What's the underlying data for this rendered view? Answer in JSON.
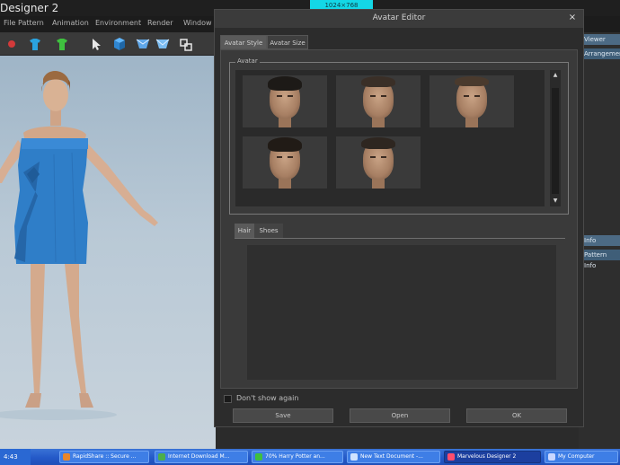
{
  "app": {
    "title": "Designer 2",
    "resolution_badge": "1024×768"
  },
  "menu": {
    "items": [
      "File",
      "Pattern",
      "Animation",
      "Environment",
      "Render",
      "Window"
    ]
  },
  "toolbar": {
    "tools": [
      "record-icon",
      "shirt-icon",
      "shirt-green-icon",
      "select-cursor-icon",
      "transform-icon",
      "cloth-icon",
      "cloth-icon",
      "sew-icon"
    ]
  },
  "right_panel": {
    "tabs": [
      "Viewer",
      "Arrangement",
      "Info",
      "Pattern Info"
    ]
  },
  "dialog": {
    "title": "Avatar Editor",
    "close_label": "×",
    "tabs": [
      "Avatar Style",
      "Avatar Size"
    ],
    "active_tab": 0,
    "avatar_group_label": "Avatar",
    "avatar_thumbnails": [
      {
        "label": "avatar-1",
        "hair": "#1d1a17"
      },
      {
        "label": "avatar-2",
        "hair": "#3a2f27"
      },
      {
        "label": "avatar-3",
        "hair": "#4a3a2d"
      },
      {
        "label": "avatar-4",
        "hair": "#211b16"
      },
      {
        "label": "avatar-5",
        "hair": "#2e2620"
      }
    ],
    "scroll_up": "▲",
    "scroll_down": "▼",
    "sub_tabs": [
      "Hair",
      "Shoes"
    ],
    "active_sub_tab": 0,
    "dont_show_label": "Don't show again",
    "buttons": {
      "save": "Save",
      "open": "Open",
      "ok": "OK"
    }
  },
  "taskbar": {
    "clock": "4:43",
    "items": [
      {
        "label": "RapidShare :: Secure ...",
        "icon_color": "#e8862a"
      },
      {
        "label": "Internet Download M...",
        "icon_color": "#4cae4c"
      },
      {
        "label": "70% Harry Potter an...",
        "icon_color": "#3fbf3f"
      },
      {
        "label": "New Text Document -...",
        "icon_color": "#cfe3ff"
      },
      {
        "label": "Marvelous Designer 2",
        "icon_color": "#ff4d6d",
        "active": true
      },
      {
        "label": "My Computer",
        "icon_color": "#c9d7ff"
      }
    ]
  },
  "colors": {
    "accent_cyan": "#14d7e6",
    "taskbar_blue": "#2459c8",
    "dialog_bg": "#2c2c2c",
    "viewport_sky": "#b9c9d6",
    "dress_blue": "#2f7ec8"
  }
}
